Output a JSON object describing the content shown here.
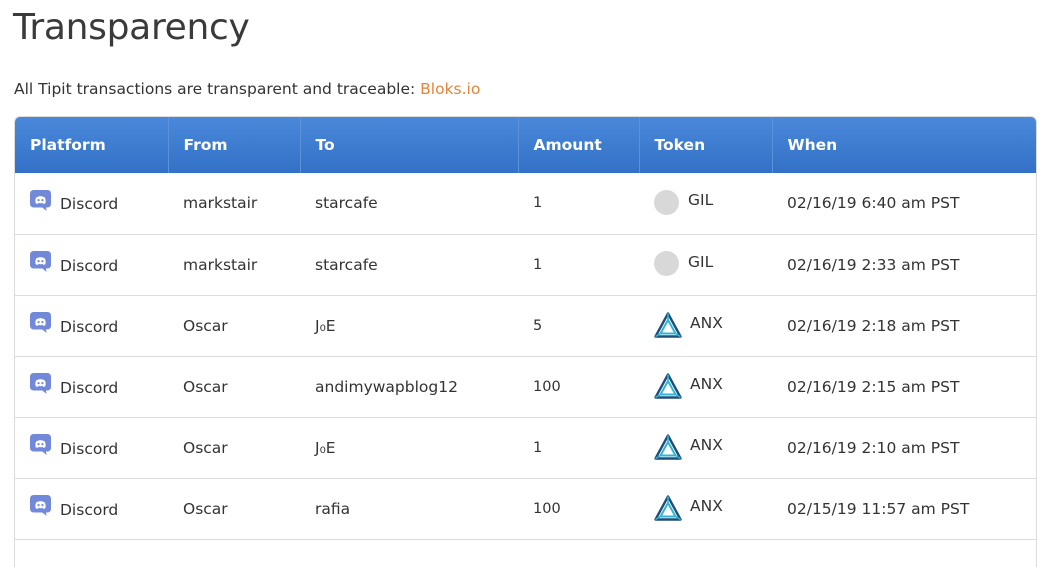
{
  "page": {
    "title": "Transparency",
    "subtitle": "All Tipit transactions are transparent and traceable: ",
    "link_text": "Bloks.io"
  },
  "table": {
    "columns": [
      "Platform",
      "From",
      "To",
      "Amount",
      "Token",
      "When"
    ],
    "rows": [
      {
        "platform": "Discord",
        "from": "markstair",
        "to": "starcafe",
        "amount": "1",
        "token": "GIL",
        "token_icon": "gil-coin-icon",
        "when": "02/16/19 6:40 am PST"
      },
      {
        "platform": "Discord",
        "from": "markstair",
        "to": "starcafe",
        "amount": "1",
        "token": "GIL",
        "token_icon": "gil-coin-icon",
        "when": "02/16/19 2:33 am PST"
      },
      {
        "platform": "Discord",
        "from": "Oscar",
        "to": "J₀E",
        "amount": "5",
        "token": "ANX",
        "token_icon": "anx-triangle-icon",
        "when": "02/16/19 2:18 am PST"
      },
      {
        "platform": "Discord",
        "from": "Oscar",
        "to": "andimywapblog12",
        "amount": "100",
        "token": "ANX",
        "token_icon": "anx-triangle-icon",
        "when": "02/16/19 2:15 am PST"
      },
      {
        "platform": "Discord",
        "from": "Oscar",
        "to": "J₀E",
        "amount": "1",
        "token": "ANX",
        "token_icon": "anx-triangle-icon",
        "when": "02/16/19 2:10 am PST"
      },
      {
        "platform": "Discord",
        "from": "Oscar",
        "to": "rafia",
        "amount": "100",
        "token": "ANX",
        "token_icon": "anx-triangle-icon",
        "when": "02/15/19 11:57 am PST"
      }
    ]
  },
  "colors": {
    "header_top": "#4a88da",
    "header_bottom": "#3371c7",
    "link": "#e8833a",
    "discord": "#7289da",
    "gil_coin": "#d8d8d8",
    "anx_dark": "#1e4f7a",
    "anx_light": "#2fb5d6"
  }
}
